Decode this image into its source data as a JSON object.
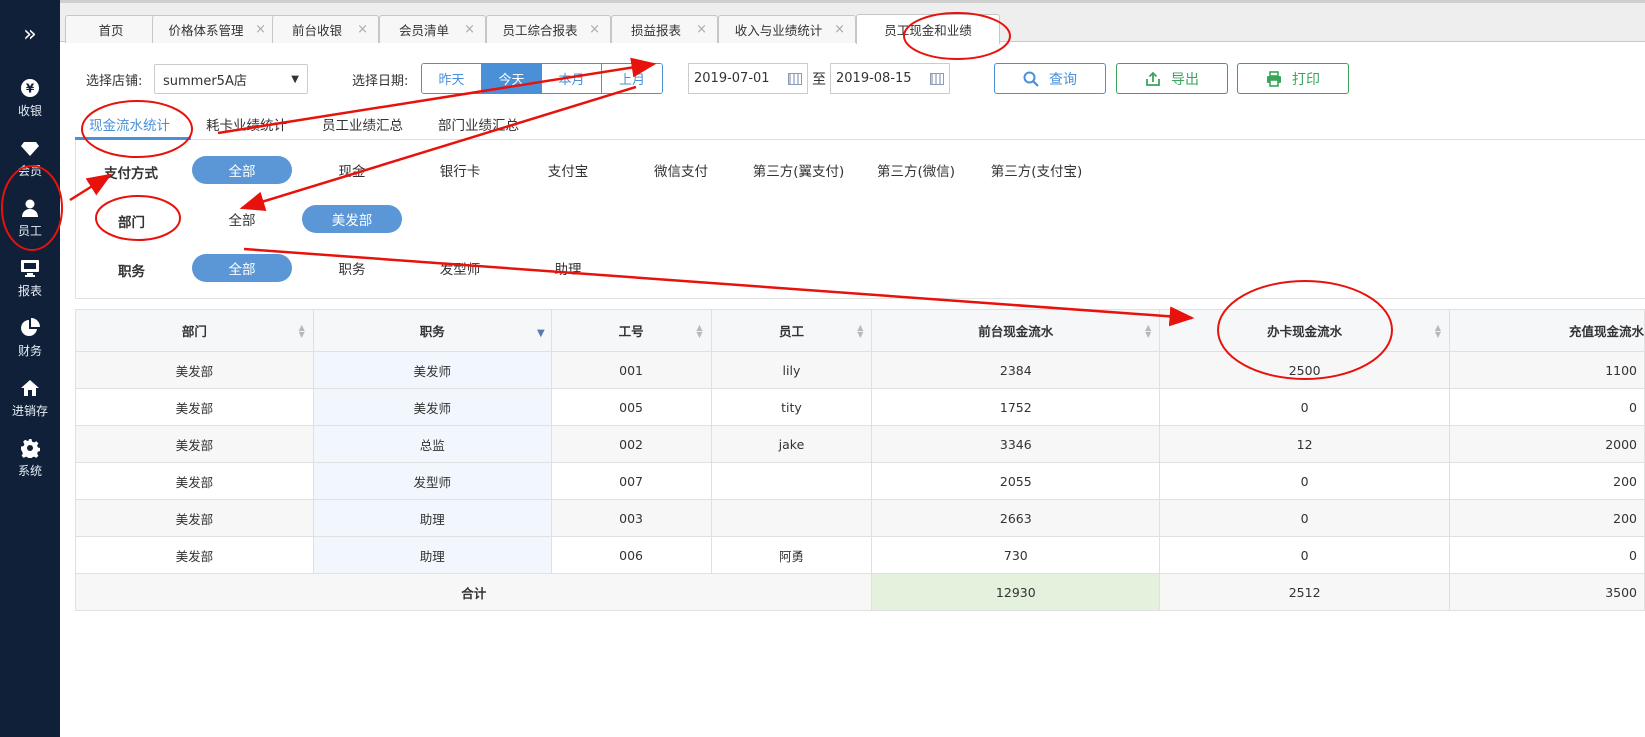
{
  "sidebar": {
    "toggle_icon": "double-chevron-right-icon",
    "items": [
      {
        "label": "收银",
        "icon": "yen-icon"
      },
      {
        "label": "会员",
        "icon": "diamond-icon"
      },
      {
        "label": "员工",
        "icon": "user-icon"
      },
      {
        "label": "报表",
        "icon": "monitor-icon"
      },
      {
        "label": "财务",
        "icon": "pie-chart-icon"
      },
      {
        "label": "进销存",
        "icon": "house-icon"
      },
      {
        "label": "系统",
        "icon": "gear-icon"
      }
    ]
  },
  "tabs": [
    {
      "label": "首页"
    },
    {
      "label": "价格体系管理",
      "close": "×"
    },
    {
      "label": "前台收银",
      "close": "×"
    },
    {
      "label": "会员清单",
      "close": "×"
    },
    {
      "label": "员工综合报表",
      "close": "×"
    },
    {
      "label": "损益报表",
      "close": "×"
    },
    {
      "label": "收入与业绩统计",
      "close": "×"
    },
    {
      "label": "员工现金和业绩",
      "close": ""
    }
  ],
  "toolbar": {
    "store_label": "选择店铺:",
    "store_value": "summer5A店",
    "store_caret": "▼",
    "date_label": "选择日期:",
    "quick_dates": [
      "昨天",
      "今天",
      "本月",
      "上月"
    ],
    "date_from": "2019-07-01",
    "date_sep": "至",
    "date_to": "2019-08-15",
    "query": "查询",
    "export": "导出",
    "print": "打印"
  },
  "subtabs": [
    "现金流水统计",
    "耗卡业绩统计",
    "员工业绩汇总",
    "部门业绩汇总"
  ],
  "filters": {
    "payment": {
      "label": "支付方式",
      "options": [
        "全部",
        "现金",
        "银行卡",
        "支付宝",
        "微信支付",
        "第三方(翼支付)",
        "第三方(微信)",
        "第三方(支付宝)"
      ]
    },
    "dept": {
      "label": "部门",
      "options": [
        "全部",
        "美发部"
      ]
    },
    "role": {
      "label": "职务",
      "options": [
        "全部",
        "职务",
        "发型师",
        "助理"
      ]
    }
  },
  "table": {
    "headers": [
      "部门",
      "职务",
      "工号",
      "员工",
      "前台现金流水",
      "办卡现金流水",
      "充值现金流水"
    ],
    "rows": [
      [
        "美发部",
        "美发师",
        "001",
        "lily",
        "2384",
        "2500",
        "1100"
      ],
      [
        "美发部",
        "美发师",
        "005",
        "tity",
        "1752",
        "0",
        "0"
      ],
      [
        "美发部",
        "总监",
        "002",
        "jake",
        "3346",
        "12",
        "2000"
      ],
      [
        "美发部",
        "发型师",
        "007",
        "",
        "2055",
        "0",
        "200"
      ],
      [
        "美发部",
        "助理",
        "003",
        "",
        "2663",
        "0",
        "200"
      ],
      [
        "美发部",
        "助理",
        "006",
        "阿勇",
        "730",
        "0",
        "0"
      ]
    ],
    "total_label": "合计",
    "totals": [
      "12930",
      "2512",
      "3500"
    ]
  },
  "colors": {
    "sidebar_bg": "#0f2038",
    "accent_blue": "#4a90d9",
    "chip_blue": "#5b97d7",
    "export_green": "#3aa55a",
    "annotation_red": "#e8120c"
  }
}
